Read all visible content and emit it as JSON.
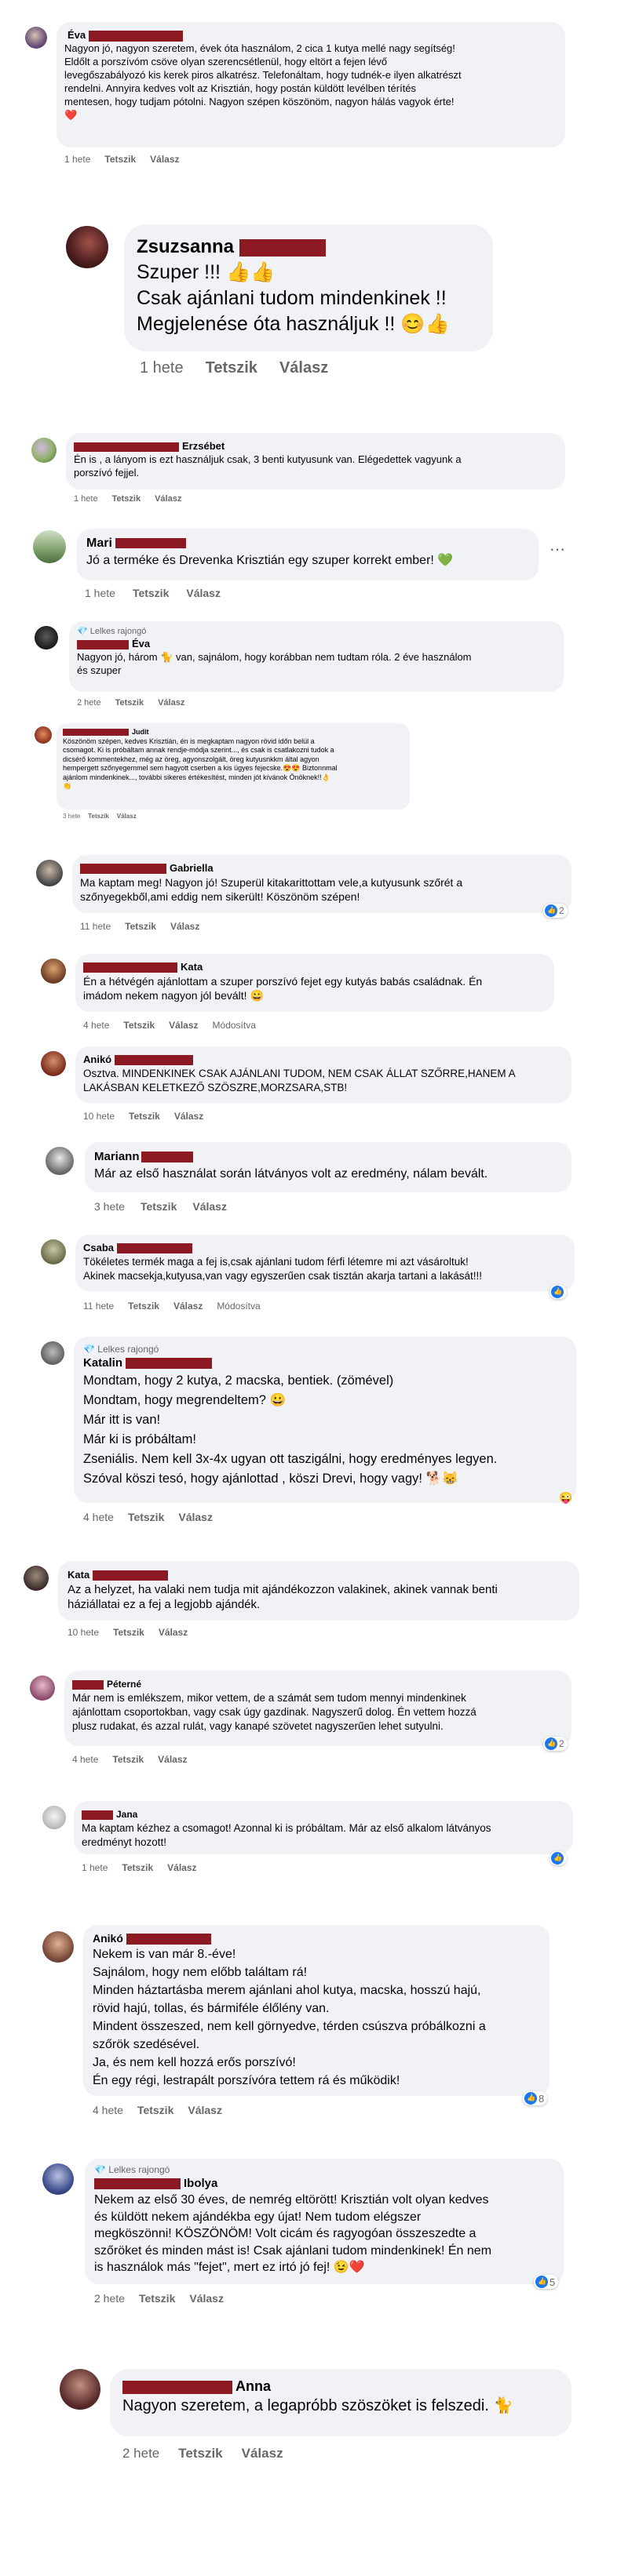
{
  "actions": {
    "like": "Tetszik",
    "reply": "Válasz",
    "modified": "Módosítva"
  },
  "badge_label": "Lelkes rajongó",
  "colors": {
    "bubble": "#f0f2f5",
    "redaction": "#8b1a22",
    "like_blue": "#1877f2",
    "meta": "#65676b"
  },
  "comments": [
    {
      "name": "Éva",
      "text": "Nagyon jó, nagyon szeretem, évek óta használom, 2 cica 1 kutya mellé nagy segítség!\nEldőlt a porszívóm csöve olyan szerencsétlenül, hogy eltört a fejen lévő\nlevegőszabályozó kis kerek piros alkatrész. Telefonáltam, hogy tudnék-e ilyen alkatrészt\nrendelni. Annyira kedves volt az Krisztián, hogy postán küldött levélben térítés\nmentesen, hogy tudjam pótolni. Nagyon szépen köszönöm, nagyon hálás vagyok érte!\n❤️",
      "time": "1 hete"
    },
    {
      "name": "Zsuzsanna",
      "text": "Szuper !!! 👍👍\nCsak ajánlani tudom mindenkinek !!\nMegjelenése óta használjuk !! 😊👍",
      "time": "1 hete"
    },
    {
      "name": "Erzsébet",
      "text": "Én is , a lányom is ezt használjuk csak, 3 benti kutyusunk van. Elégedettek vagyunk a\nporszívó fejjel.",
      "time": "1 hete"
    },
    {
      "name": "Mari",
      "text": "Jó a terméke és Drevenka Krisztián egy szuper korrekt ember! 💚",
      "time": "1 hete"
    },
    {
      "name": "Éva",
      "text": "Nagyon jó, három 🐈 van, sajnálom, hogy korábban nem tudtam róla. 2 éve használom\nés szuper",
      "time": "2 hete"
    },
    {
      "name": "Judit",
      "text": "Köszönöm szépen, kedves Krisztián, én is megkaptam nagyon rövid időn belül a\ncsomagot. Ki is próbáltam annak rendje-módja szerint..., és csak is csatlakozni tudok a\ndicsérő kommentekhez, még az öreg, agyonszolgált, öreg kutyusnkkm által agyon\nhempergett szőnyegemmel sem hagyott cserben a kis ügyes fejecske.😍😍 Biztonnmal\najánlom mindenkinek..., további sikeres értékesítést, minden jót kívánok Önöknek!!👌\n👏",
      "time": "3 hete"
    },
    {
      "name": "Gabriella",
      "text": "Ma kaptam meg! Nagyon jó! Szuperül kitakarittottam vele,a kutyusunk szőrét a\nszőnyegekből,ami eddig nem sikerült! Köszönöm szépen!",
      "time": "11 hete",
      "reactions": "2"
    },
    {
      "name": "Kata",
      "text": "Én a hétvégén ajánlottam a szuper porszívó fejet egy kutyás babás családnak. Én\nimádom nekem nagyon jól bevált! 😀",
      "time": "4 hete"
    },
    {
      "name": "Anikó",
      "text": "Osztva. MINDENKINEK CSAK AJÁNLANI TUDOM, NEM CSAK ÁLLAT SZŐRRE,HANEM A\nLAKÁSBAN KELETKEZŐ SZÖSZRE,MORZSARA,STB!",
      "time": "10 hete"
    },
    {
      "name": "Mariann",
      "text": "Már az első használat során látványos volt az eredmény, nálam bevált.",
      "time": "3 hete"
    },
    {
      "name": "Csaba",
      "text": "Tökéletes termék maga a fej is,csak ajánlani tudom férfi létemre mi azt vásároltuk!\nAkinek macsekja,kutyusa,van vagy egyszerűen csak tisztán akarja tartani a lakását!!!",
      "time": "11 hete"
    },
    {
      "name": "Katalin",
      "text": "Mondtam, hogy 2 kutya, 2 macska, bentiek. (zömével)\nMondtam, hogy megrendeltem? 😀\nMár itt is van!\nMár ki is próbáltam!\nZseniális. Nem kell 3x-4x ugyan ott taszigálni, hogy eredményes legyen.\nSzóval köszi tesó, hogy ajánlottad , köszi Drevi, hogy vagy! 🐕😸",
      "time": "4 hete"
    },
    {
      "name": "Kata",
      "text": "Az a helyzet, ha valaki nem tudja mit ajándékozzon valakinek, akinek vannak benti\nháziállatai ez a fej a legjobb ajándék.",
      "time": "10 hete"
    },
    {
      "name": "Péterné",
      "text": "Már nem is emlékszem, mikor vettem, de a számát sem tudom mennyi mindenkinek\najánlottam csoportokban, vagy csak úgy gazdinak. Nagyszerű dolog. Én vettem hozzá\nplusz rudakat, és azzal rulát, vagy kanapé szövetet nagyszerűen lehet sutyulni.",
      "time": "4 hete",
      "reactions": "2"
    },
    {
      "name": "Jana",
      "text": "Ma kaptam kézhez a csomagot! Azonnal ki is próbáltam. Már az első alkalom látványos\neredményt hozott!",
      "time": "1 hete"
    },
    {
      "name": "Anikó",
      "text": "Nekem is van már 8.-éve!\nSajnálom, hogy nem előbb találtam rá!\nMinden háztartásba merem ajánlani ahol kutya, macska, hosszú hajú,\nrövid hajú, tollas, és bármiféle élőlény van.\nMindent összeszed, nem kell görnyedve, térden csúszva próbálkozni a\nszőrök szedésével.\nJa, és nem kell hozzá erős porszívó!\nÉn egy régi, lestrapált porszívóra tettem rá és működik!",
      "time": "4 hete",
      "reactions": "8"
    },
    {
      "name": "Ibolya",
      "text": "Nekem az első 30 éves, de nemrég eltörött! Krisztián volt olyan kedves\nés küldött nekem ajándékba egy újat! Nem tudom elégszer\nmegköszönni! KÖSZÖNÖM! Volt cicám és ragyogóan összeszedte a\nszőröket és minden mást is! Csak ajánlani tudom mindenkinek! Én nem\nis használok más \"fejet\", mert ez irtó jó fej! 😉❤️",
      "time": "2 hete",
      "reactions": "5"
    },
    {
      "name": "Anna",
      "text": "Nagyon szeretem, a legapróbb szöszöket is felszedi. 🐈",
      "time": "2 hete"
    }
  ]
}
